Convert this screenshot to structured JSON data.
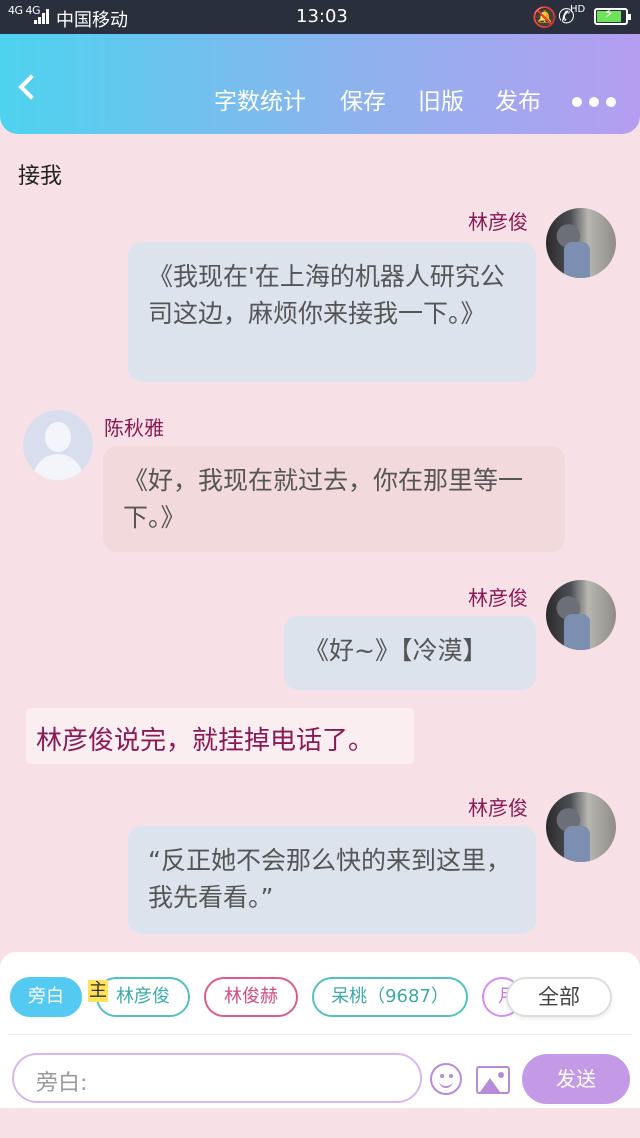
{
  "status_bar": {
    "signal": "4G 4G",
    "carrier": "中国移动",
    "time": "13:03",
    "hd": "HD"
  },
  "header": {
    "word_count": "字数统计",
    "save": "保存",
    "old_version": "旧版",
    "publish": "发布"
  },
  "title": "接我",
  "messages": [
    {
      "speaker": "林彦俊",
      "text": "《我现在'在上海的机器人研究公司这边，麻烦你来接我一下。》",
      "side": "right"
    },
    {
      "speaker": "陈秋雅",
      "text": "《好，我现在就过去，你在那里等一下。》",
      "side": "left"
    },
    {
      "speaker": "林彦俊",
      "text": "《好~》【冷漠】",
      "side": "right"
    },
    {
      "narration": "林彦俊说完，就挂掉电话了。"
    },
    {
      "speaker": "林彦俊",
      "text": "“反正她不会那么快的来到这里，我先看看。”",
      "side": "right"
    }
  ],
  "role_chips": [
    "旁白",
    "林彦俊",
    "林俊赫",
    "呆桃（9687）",
    "月"
  ],
  "main_marker": "主",
  "all_button": "全部",
  "input_placeholder": "旁白:",
  "send_label": "发送",
  "colors": {
    "accent_purple": "#c49ae6",
    "name_color": "#8a1a55",
    "active_chip": "#54c9f2"
  }
}
